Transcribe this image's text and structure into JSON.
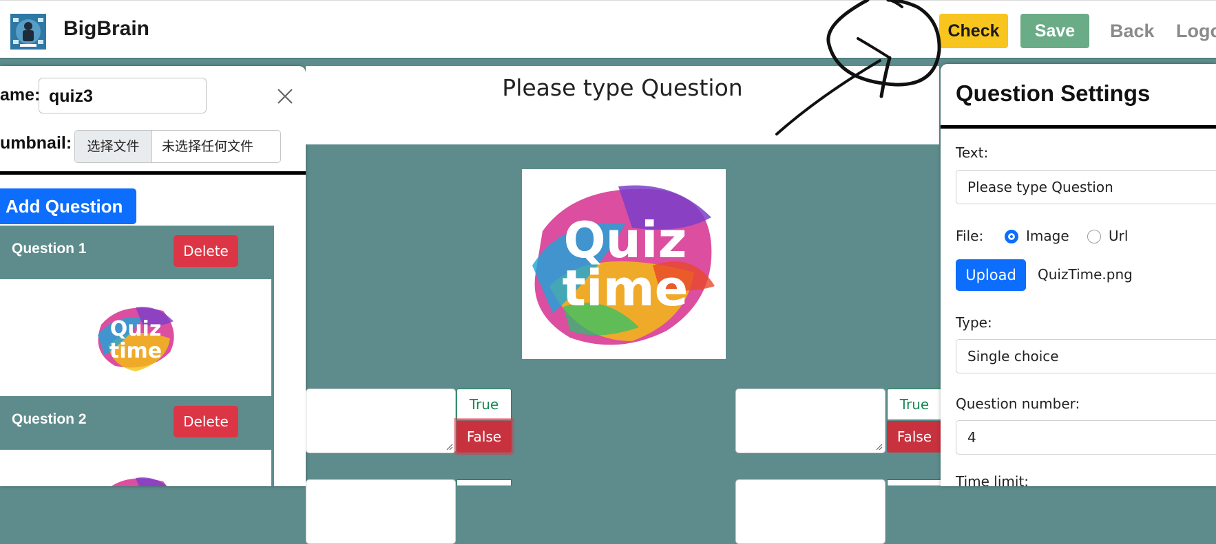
{
  "header": {
    "brand": "BigBrain",
    "check_label": "Check",
    "save_label": "Save",
    "back_label": "Back",
    "logout_label": "Logo"
  },
  "quiz": {
    "name_label": "ame:",
    "name_value": "quiz3",
    "thumbnail_label": "umbnail:",
    "file_button": "选择文件",
    "file_status": "未选择任何文件",
    "add_question_label": "Add Question",
    "questions": [
      {
        "title": "Question 1",
        "delete_label": "Delete"
      },
      {
        "title": "Question 2",
        "delete_label": "Delete"
      }
    ]
  },
  "editor": {
    "question_text": "Please type Question",
    "answers": [
      {
        "true_label": "True",
        "false_label": "False"
      },
      {
        "true_label": "True",
        "false_label": "False"
      }
    ]
  },
  "settings": {
    "title": "Question Settings",
    "text_label": "Text:",
    "text_value": "Please type Question",
    "file_label": "File:",
    "file_options": [
      "Image",
      "Url"
    ],
    "file_selected": "Image",
    "upload_label": "Upload",
    "uploaded_file": "QuizTime.png",
    "type_label": "Type:",
    "type_value": "Single choice",
    "question_number_label": "Question number:",
    "question_number_value": "4",
    "time_limit_label": "Time limit:"
  },
  "colors": {
    "teal": "#5e8c8c",
    "check": "#f7c51e",
    "save": "#6aac86",
    "primary": "#0d6efd",
    "danger": "#dc3545"
  }
}
